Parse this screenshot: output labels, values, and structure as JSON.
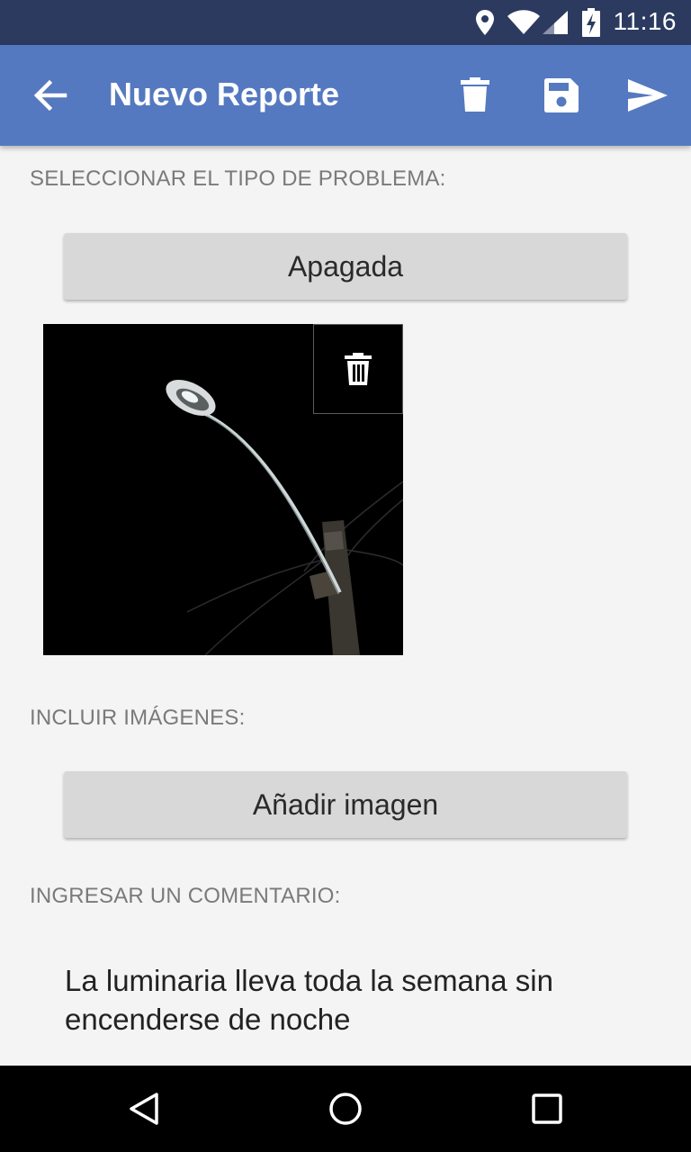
{
  "status_bar": {
    "time": "11:16",
    "icons": [
      "location-icon",
      "wifi-icon",
      "signal-icon",
      "battery-charging-icon"
    ]
  },
  "app_bar": {
    "title": "Nuevo Reporte",
    "icons": [
      "back-arrow-icon",
      "delete-icon",
      "save-icon",
      "send-icon"
    ],
    "background_color": "#5579c0"
  },
  "problem_section": {
    "label": "SELECCIONAR EL TIPO DE PROBLEMA:",
    "selected_type": "Apagada"
  },
  "photo": {
    "subject": "streetlight",
    "delete_icon": "trash-icon"
  },
  "images_section": {
    "label": "INCLUIR IMÁGENES:",
    "add_button_label": "Añadir imagen"
  },
  "comment_section": {
    "label": "INGRESAR UN COMENTARIO:",
    "text": "La luminaria lleva toda la semana sin encenderse de noche"
  },
  "nav_bar": {
    "icons": [
      "back-triangle-icon",
      "home-circle-icon",
      "recents-square-icon"
    ]
  }
}
